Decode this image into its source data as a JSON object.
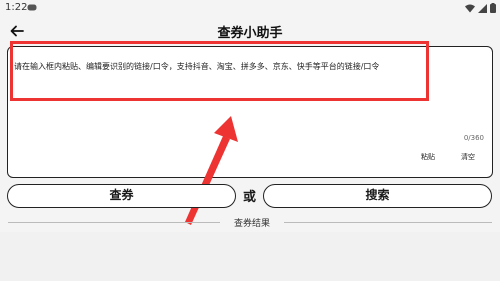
{
  "status_bar": {
    "time": "1:22"
  },
  "app_bar": {
    "title": "查券小助手"
  },
  "input": {
    "placeholder": "请在输入框内粘贴、编辑要识别的链接/口令，支持抖音、淘宝、拼多多、京东、快手等平台的链接/口令",
    "char_count": "0/360",
    "paste_label": "粘贴",
    "clear_label": "清空"
  },
  "actions": {
    "query_label": "查券",
    "or_label": "或",
    "search_label": "搜索"
  },
  "results": {
    "title": "查券结果"
  },
  "annotation": {
    "color": "#ee3333"
  }
}
